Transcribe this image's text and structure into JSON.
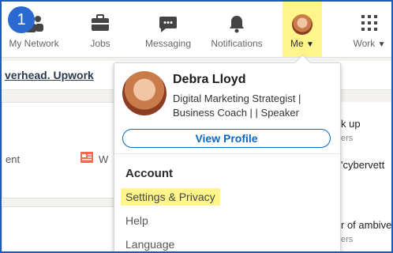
{
  "badge": "1",
  "nav": {
    "my_network": "My Network",
    "jobs": "Jobs",
    "messaging": "Messaging",
    "notifications": "Notifications",
    "me": "Me",
    "work": "Work"
  },
  "feed": {
    "promo": "verhead. Upwork",
    "left_label": "ent",
    "left_letter": "W",
    "right1": "k up",
    "right1_sub": "ers",
    "right2": "'cybervett",
    "right3": "r of ambive",
    "right3_sub": "ers"
  },
  "profile": {
    "name": "Debra Lloyd",
    "headline": "Digital Marketing Strategist | Business Coach | | Speaker",
    "view_profile": "View Profile"
  },
  "account": {
    "title": "Account",
    "items": [
      "Settings & Privacy",
      "Help",
      "Language"
    ]
  },
  "colors": {
    "highlight": "#fff58a",
    "linkedin_blue": "#0a66c2",
    "badge_blue": "#2a6ad0"
  }
}
